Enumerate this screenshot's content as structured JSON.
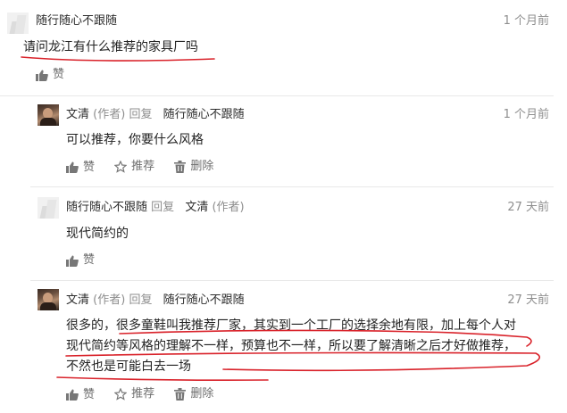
{
  "comments": [
    {
      "author": "随行随心不跟随",
      "time": "1 个月前",
      "text": "请问龙江有什么推荐的家具厂吗",
      "actions": {
        "like": "赞"
      }
    },
    {
      "author": "文清",
      "author_tag": "(作者)",
      "reply_word": "回复",
      "reply_to": "随行随心不跟随",
      "time": "1 个月前",
      "text": "可以推荐，你要什么风格",
      "actions": {
        "like": "赞",
        "recommend": "推荐",
        "delete": "删除"
      }
    },
    {
      "author": "随行随心不跟随",
      "reply_word": "回复",
      "reply_to": "文清",
      "reply_to_tag": "(作者)",
      "time": "27 天前",
      "text": "现代简约的",
      "actions": {
        "like": "赞"
      }
    },
    {
      "author": "文清",
      "author_tag": "(作者)",
      "reply_word": "回复",
      "reply_to": "随行随心不跟随",
      "time": "27 天前",
      "text_lines": [
        "很多的，很多童鞋叫我推荐厂家，其实到一个工厂的选择余地有限，加上每个人对",
        "现代简约等风格的理解不一样，预算也不一样，所以要了解清晰之后才好做推荐，",
        "不然也是可能白去一场"
      ],
      "actions": {
        "like": "赞",
        "recommend": "推荐",
        "delete": "删除"
      }
    }
  ],
  "annotation_color": "#d9222a"
}
